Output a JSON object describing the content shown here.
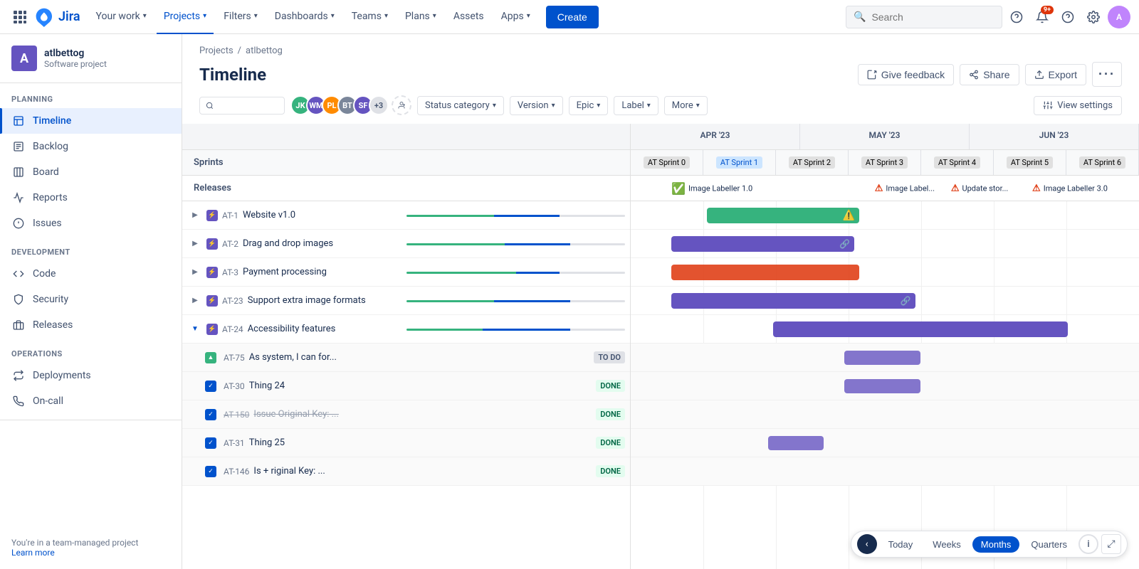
{
  "topnav": {
    "logo_text": "Jira",
    "items": [
      {
        "label": "Your work",
        "has_chevron": true,
        "active": false
      },
      {
        "label": "Projects",
        "has_chevron": true,
        "active": true
      },
      {
        "label": "Filters",
        "has_chevron": true,
        "active": false
      },
      {
        "label": "Dashboards",
        "has_chevron": true,
        "active": false
      },
      {
        "label": "Teams",
        "has_chevron": true,
        "active": false
      },
      {
        "label": "Plans",
        "has_chevron": true,
        "active": false
      },
      {
        "label": "Assets",
        "has_chevron": false,
        "active": false
      },
      {
        "label": "Apps",
        "has_chevron": true,
        "active": false
      }
    ],
    "create_label": "Create",
    "search_placeholder": "Search",
    "notification_count": "9+"
  },
  "sidebar": {
    "project_name": "atlbettog",
    "project_type": "Software project",
    "planning_label": "PLANNING",
    "planning_items": [
      {
        "label": "Timeline",
        "active": true
      },
      {
        "label": "Backlog",
        "active": false
      },
      {
        "label": "Board",
        "active": false
      },
      {
        "label": "Reports",
        "active": false
      },
      {
        "label": "Issues",
        "active": false
      }
    ],
    "development_label": "DEVELOPMENT",
    "development_items": [
      {
        "label": "Code",
        "active": false
      },
      {
        "label": "Security",
        "active": false
      },
      {
        "label": "Releases",
        "active": false
      }
    ],
    "operations_label": "OPERATIONS",
    "operations_items": [
      {
        "label": "Deployments",
        "active": false
      },
      {
        "label": "On-call",
        "active": false
      }
    ],
    "footer_text": "You're in a team-managed project",
    "learn_more": "Learn more"
  },
  "page": {
    "breadcrumb_projects": "Projects",
    "breadcrumb_project": "atlbettog",
    "title": "Timeline"
  },
  "page_actions": {
    "give_feedback": "Give feedback",
    "share": "Share",
    "export": "Export",
    "more": "..."
  },
  "toolbar": {
    "filters": [
      {
        "label": "Status category",
        "has_chevron": true
      },
      {
        "label": "Version",
        "has_chevron": true
      },
      {
        "label": "Epic",
        "has_chevron": true
      },
      {
        "label": "Label",
        "has_chevron": true
      },
      {
        "label": "More",
        "has_chevron": true
      }
    ],
    "view_settings": "View settings",
    "avatar_count": "+3"
  },
  "timeline": {
    "months": [
      "APR '23",
      "MAY '23",
      "JUN '23"
    ],
    "sprints_label": "Sprints",
    "releases_label": "Releases",
    "sprint_items": [
      {
        "label": "AT Sprint 0",
        "active": false
      },
      {
        "label": "AT Sprint 1",
        "active": true
      },
      {
        "label": "AT Sprint 2",
        "active": false
      },
      {
        "label": "AT Sprint 3",
        "active": false
      },
      {
        "label": "AT Sprint 4",
        "active": false
      },
      {
        "label": "AT Sprint 5",
        "active": false
      },
      {
        "label": "AT Sprint 6",
        "active": false
      }
    ],
    "releases": [
      {
        "label": "Image Labeller 1.0",
        "type": "success",
        "offset": 12
      },
      {
        "label": "Image Label...",
        "type": "error",
        "offset": 38
      },
      {
        "label": "Update stor...",
        "type": "error",
        "offset": 52
      },
      {
        "label": "Image Labeller 3.0",
        "type": "error",
        "offset": 66
      }
    ],
    "rows": [
      {
        "id": "AT-1",
        "type": "epic",
        "summary": "Website v1.0",
        "expand": true,
        "expanded": false,
        "bar_color": "green",
        "bar_left": "18%",
        "bar_width": "28%",
        "progress": [
          30,
          40,
          30
        ],
        "has_warning": true
      },
      {
        "id": "AT-2",
        "type": "epic",
        "summary": "Drag and drop images",
        "expand": true,
        "expanded": false,
        "bar_color": "purple",
        "bar_left": "10%",
        "bar_width": "34%",
        "progress": [
          45,
          30,
          25
        ],
        "has_link": true
      },
      {
        "id": "AT-3",
        "type": "epic",
        "summary": "Payment processing",
        "expand": true,
        "expanded": false,
        "bar_color": "red",
        "bar_left": "10%",
        "bar_width": "35%",
        "progress": [
          50,
          20,
          30
        ]
      },
      {
        "id": "AT-23",
        "type": "epic",
        "summary": "Support extra image formats",
        "expand": true,
        "expanded": false,
        "bar_color": "purple",
        "bar_left": "10%",
        "bar_width": "46%",
        "progress": [
          40,
          35,
          25
        ],
        "has_link": true
      },
      {
        "id": "AT-24",
        "type": "epic",
        "summary": "Accessibility features",
        "expand": true,
        "expanded": true,
        "bar_color": "purple",
        "bar_left": "28%",
        "bar_width": "56%",
        "progress": [
          35,
          40,
          25
        ]
      },
      {
        "id": "AT-75",
        "type": "story",
        "summary": "As system, I can for...",
        "expand": false,
        "expanded": false,
        "indent": true,
        "status": "TO DO",
        "status_type": "todo",
        "bar_color": "purple",
        "bar_left": "38%",
        "bar_width": "14%"
      },
      {
        "id": "AT-30",
        "type": "task",
        "summary": "Thing 24",
        "expand": false,
        "expanded": false,
        "indent": true,
        "status": "DONE",
        "status_type": "done",
        "bar_color": "purple",
        "bar_left": "38%",
        "bar_width": "14%"
      },
      {
        "id": "AT-150",
        "type": "task",
        "summary": "Issue Original Key: ...",
        "expand": false,
        "expanded": false,
        "indent": true,
        "status": "DONE",
        "status_type": "done",
        "strikethrough": true
      },
      {
        "id": "AT-31",
        "type": "task",
        "summary": "Thing 25",
        "expand": false,
        "expanded": false,
        "indent": true,
        "status": "DONE",
        "status_type": "done",
        "bar_color": "purple",
        "bar_left": "26%",
        "bar_width": "10%"
      },
      {
        "id": "AT-146",
        "type": "task",
        "summary": "Is + riginal Key: ...",
        "expand": false,
        "expanded": false,
        "indent": true,
        "status": "DONE",
        "status_type": "done"
      }
    ]
  },
  "bottom_nav": {
    "today": "Today",
    "weeks": "Weeks",
    "months": "Months",
    "quarters": "Quarters"
  }
}
